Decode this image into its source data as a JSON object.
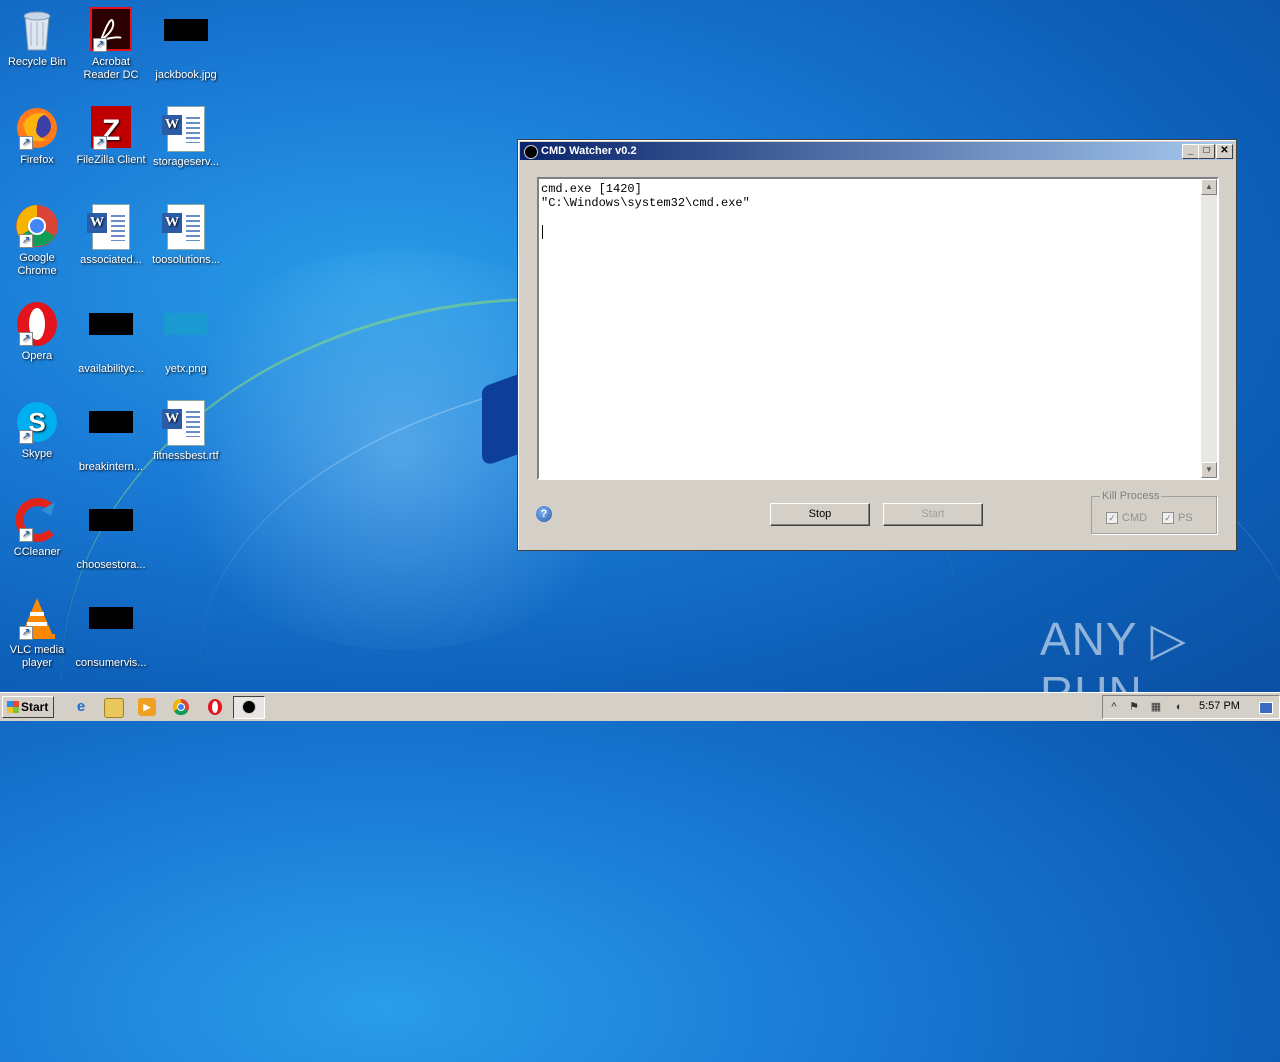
{
  "desktop": {
    "icons": [
      {
        "label": "Recycle Bin"
      },
      {
        "label": "Acrobat Reader DC"
      },
      {
        "label": "jackbook.jpg"
      },
      {
        "label": "Firefox"
      },
      {
        "label": "FileZilla Client"
      },
      {
        "label": "storageserv..."
      },
      {
        "label": "Google Chrome"
      },
      {
        "label": "associated..."
      },
      {
        "label": "toosolutions..."
      },
      {
        "label": "Opera"
      },
      {
        "label": "availabilityc..."
      },
      {
        "label": "yetx.png"
      },
      {
        "label": "Skype"
      },
      {
        "label": "breakintern..."
      },
      {
        "label": "fitnessbest.rtf"
      },
      {
        "label": "CCleaner"
      },
      {
        "label": "choosestora..."
      },
      {
        "label": "VLC media player"
      },
      {
        "label": "consumervis..."
      }
    ],
    "watermark": "ANY ▷ RUN"
  },
  "window": {
    "title": "CMD Watcher v0.2",
    "minimize": "_",
    "maximize": "□",
    "close": "✕",
    "log_text": "cmd.exe [1420]\n\"C:\\Windows\\system32\\cmd.exe\"",
    "help_glyph": "?",
    "stop_label": "Stop",
    "start_label": "Start",
    "kill_process": {
      "legend": "Kill Process",
      "cmd_label": "CMD",
      "ps_label": "PS",
      "cmd_checked": true,
      "ps_checked": true
    }
  },
  "taskbar": {
    "start_label": "Start",
    "clock": "5:57 PM"
  },
  "colors": {
    "titlebar_start": "#0a246a",
    "titlebar_end": "#a6caf0",
    "desktop_blue": "#1a7bd6"
  }
}
